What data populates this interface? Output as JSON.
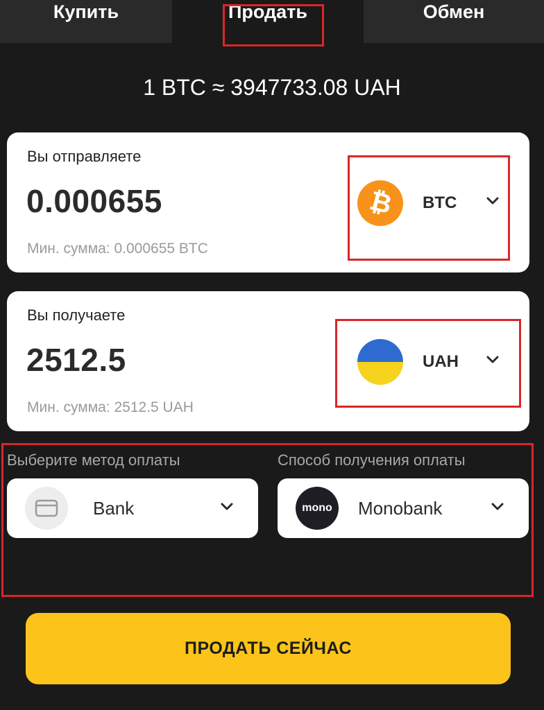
{
  "tabs": {
    "buy": "Купить",
    "sell": "Продать",
    "exchange": "Обмен"
  },
  "rate": "1 BTC ≈ 3947733.08 UAH",
  "send": {
    "label": "Вы отправляете",
    "amount": "0.000655",
    "min": "Мин. сумма: 0.000655 BTC",
    "currency": "BTC",
    "icon": "bitcoin-icon",
    "symbol": "₿"
  },
  "receive": {
    "label": "Вы получаете",
    "amount": "2512.5",
    "min": "Мин. сумма: 2512.5 UAH",
    "currency": "UAH",
    "icon": "ukraine-flag-icon"
  },
  "payment": {
    "method_label": "Выберите метод оплаты",
    "method_value": "Bank",
    "receive_label": "Способ получения оплаты",
    "receive_value": "Monobank",
    "mono_logo_text": "mono"
  },
  "action": {
    "sell_now": "ПРОДАТЬ СЕЙЧАС"
  },
  "colors": {
    "background": "#1a1a1a",
    "accent": "#fcc41a",
    "highlight": "#d9262a",
    "btc": "#f7931a"
  }
}
